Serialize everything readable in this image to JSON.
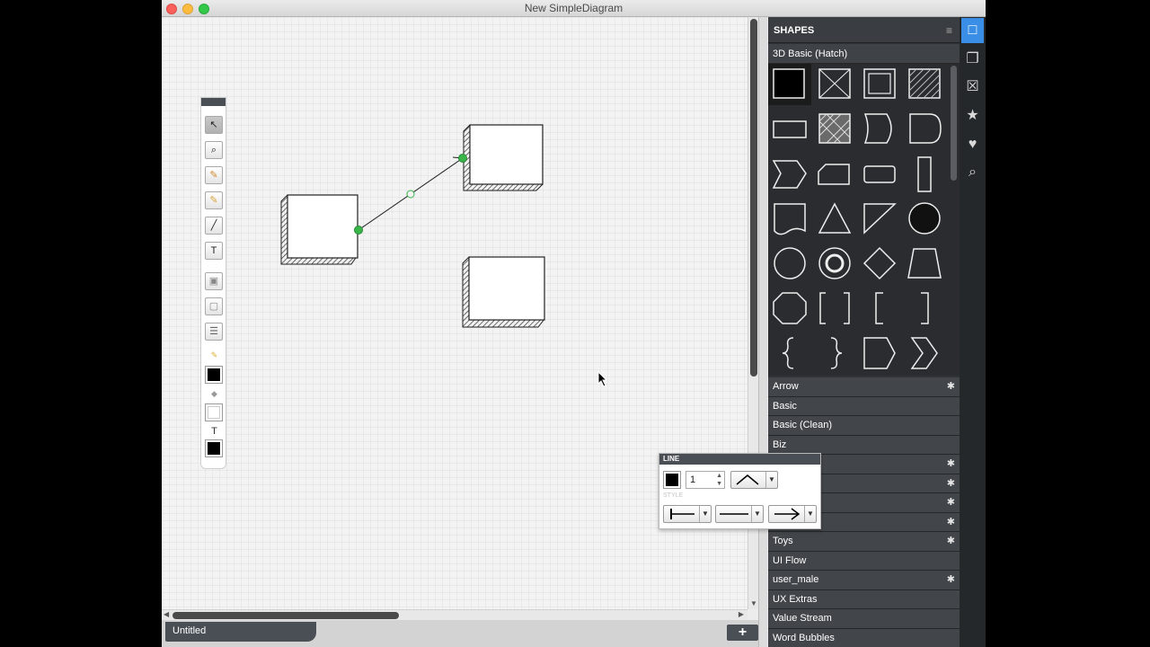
{
  "window": {
    "title": "New SimpleDiagram"
  },
  "document": {
    "tab_label": "Untitled",
    "add_page_label": "+"
  },
  "toolbar": {
    "tools": [
      {
        "name": "select",
        "glyph": "↖"
      },
      {
        "name": "zoom",
        "glyph": "⌕"
      },
      {
        "name": "pencil",
        "glyph": "✎"
      },
      {
        "name": "highlighter",
        "glyph": "✎"
      },
      {
        "name": "line",
        "glyph": "╱"
      },
      {
        "name": "text",
        "glyph": "T"
      },
      {
        "name": "bring-front",
        "glyph": "▣"
      },
      {
        "name": "send-back",
        "glyph": "▢"
      },
      {
        "name": "arrange",
        "glyph": "☰"
      }
    ],
    "text_tool_label": "T",
    "colors": {
      "stroke": "#000000",
      "fill": "#ffffff",
      "text": "#000000"
    }
  },
  "panel": {
    "title": "SHAPES",
    "section": "3D Basic (Hatch)",
    "categories": [
      {
        "label": "Arrow",
        "star": "✱"
      },
      {
        "label": "Basic",
        "star": ""
      },
      {
        "label": "Basic (Clean)",
        "star": ""
      },
      {
        "label": "Biz",
        "star": ""
      },
      {
        "label": "",
        "star": "✱"
      },
      {
        "label": "",
        "star": "✱"
      },
      {
        "label": "",
        "star": "✱"
      },
      {
        "label": "",
        "star": "✱"
      },
      {
        "label": "Toys",
        "star": "✱"
      },
      {
        "label": "UI Flow",
        "star": ""
      },
      {
        "label": "user_male",
        "star": "✱"
      },
      {
        "label": "UX Extras",
        "star": ""
      },
      {
        "label": "Value Stream",
        "star": ""
      },
      {
        "label": "Word Bubbles",
        "star": ""
      }
    ]
  },
  "line_popup": {
    "title": "LINE",
    "width_value": "1",
    "style_label": "STYLE",
    "color": "#000000"
  },
  "colors": {
    "panel_bg": "#2f3236",
    "accent": "#3a8ee6",
    "connector": "#39b54a"
  }
}
